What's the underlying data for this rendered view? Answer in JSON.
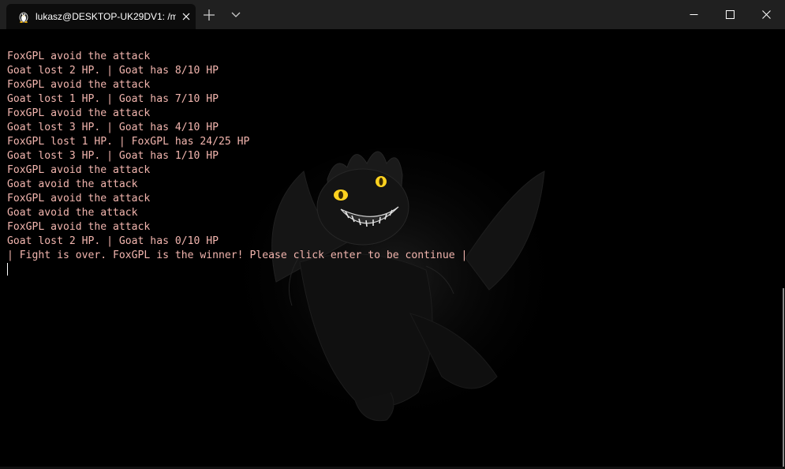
{
  "tab": {
    "title": "lukasz@DESKTOP-UK29DV1: /m",
    "icon": "linux-penguin-icon"
  },
  "titlebar": {
    "new_tab_icon": "plus-icon",
    "dropdown_icon": "chevron-down-icon",
    "minimize_icon": "minimize-icon",
    "maximize_icon": "maximize-icon",
    "close_icon": "close-icon"
  },
  "terminal": {
    "text_color": "#f2b5ae",
    "background_color": "#000000",
    "background_image": "dark-dragon-character",
    "lines": [
      "FoxGPL avoid the attack",
      "Goat lost 2 HP. | Goat has 8/10 HP",
      "FoxGPL avoid the attack",
      "Goat lost 1 HP. | Goat has 7/10 HP",
      "FoxGPL avoid the attack",
      "Goat lost 3 HP. | Goat has 4/10 HP",
      "FoxGPL lost 1 HP. | FoxGPL has 24/25 HP",
      "Goat lost 3 HP. | Goat has 1/10 HP",
      "FoxGPL avoid the attack",
      "Goat avoid the attack",
      "FoxGPL avoid the attack",
      "Goat avoid the attack",
      "FoxGPL avoid the attack",
      "Goat lost 2 HP. | Goat has 0/10 HP",
      "| Fight is over. FoxGPL is the winner! Please click enter to be continue |"
    ]
  }
}
